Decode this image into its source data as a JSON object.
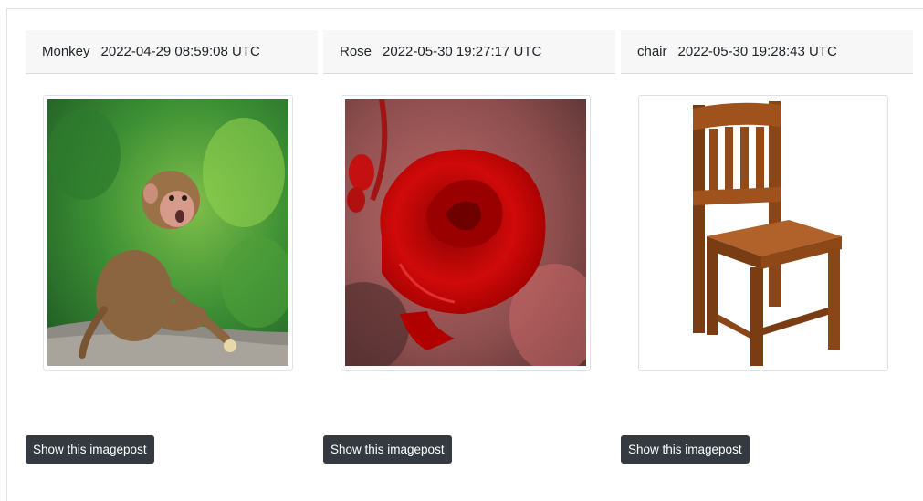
{
  "posts": [
    {
      "name": "Monkey",
      "timestamp": "2022-04-29 08:59:08 UTC",
      "button_label": "Show this imagepost",
      "image_icon": "monkey-image"
    },
    {
      "name": "Rose",
      "timestamp": "2022-05-30 19:27:17 UTC",
      "button_label": "Show this imagepost",
      "image_icon": "rose-image"
    },
    {
      "name": "chair",
      "timestamp": "2022-05-30 19:28:43 UTC",
      "button_label": "Show this imagepost",
      "image_icon": "chair-image"
    }
  ],
  "colors": {
    "button_bg": "#343a40",
    "header_bg": "#f7f7f7",
    "border": "#dee2e6"
  }
}
